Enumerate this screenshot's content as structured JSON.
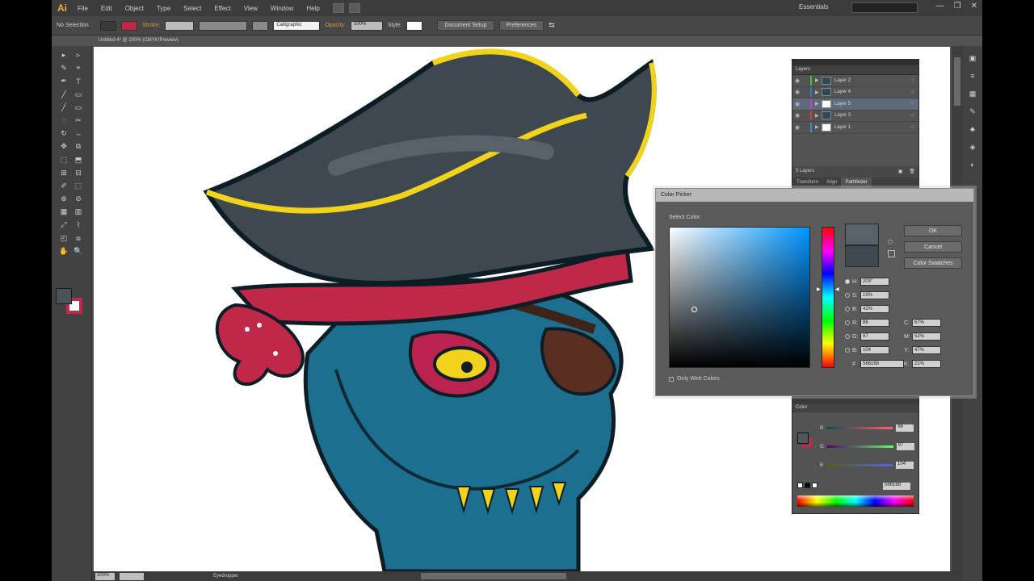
{
  "app": {
    "logo": "Ai",
    "menu": [
      "File",
      "Edit",
      "Object",
      "Type",
      "Select",
      "Effect",
      "View",
      "Window",
      "Help"
    ],
    "workspace": "Essentials",
    "window_controls": [
      "—",
      "❐",
      "✕"
    ]
  },
  "control_bar": {
    "selection_label": "No Selection",
    "stroke_label": "Stroke:",
    "brush_value": "Calligraphic",
    "opacity_label": "Opacity:",
    "opacity_value": "100%",
    "style_label": "Style:",
    "document_setup": "Document Setup",
    "preferences": "Preferences"
  },
  "document": {
    "tab_title": "Untitled-4* @ 200% (CMYK/Preview)"
  },
  "status_bar": {
    "zoom": "200%",
    "tool_name": "Eyedropper"
  },
  "layers_panel": {
    "title": "Layers",
    "layers": [
      {
        "name": "Layer 2",
        "color": "#37c837",
        "selected": false,
        "has_thumb_art": true
      },
      {
        "name": "Layer 4",
        "color": "#3d6fd6",
        "selected": false,
        "has_thumb_art": true
      },
      {
        "name": "Layer 5",
        "color": "#c43bd6",
        "selected": true,
        "has_thumb_art": false
      },
      {
        "name": "Layer 3",
        "color": "#d63b3b",
        "selected": false,
        "has_thumb_art": true
      },
      {
        "name": "Layer 1",
        "color": "#3b8ad6",
        "selected": false,
        "has_thumb_art": false
      }
    ],
    "footer_count": "5 Layers",
    "tabs": [
      "Transform",
      "Align",
      "Pathfinder"
    ],
    "active_tab": "Pathfinder"
  },
  "color_picker": {
    "title": "Color Picker",
    "select_label": "Select Color:",
    "buttons": {
      "ok": "OK",
      "cancel": "Cancel",
      "swatches": "Color Swatches"
    },
    "fields": {
      "H": {
        "label": "H:",
        "value": "203°"
      },
      "S": {
        "label": "S:",
        "value": "19%"
      },
      "B": {
        "label": "B:",
        "value": "42%"
      },
      "R": {
        "label": "R:",
        "value": "86"
      },
      "G": {
        "label": "G:",
        "value": "97"
      },
      "B2": {
        "label": "B:",
        "value": "104"
      },
      "C": {
        "label": "C:",
        "value": "67%"
      },
      "M": {
        "label": "M:",
        "value": "52%"
      },
      "Y": {
        "label": "Y:",
        "value": "47%"
      },
      "K": {
        "label": "K:",
        "value": "21%"
      },
      "hex": {
        "label": "#",
        "value": "566168"
      }
    },
    "web_only": "Only Web Colors",
    "new_color": "#566168",
    "old_color": "#3e484f"
  },
  "color_panel": {
    "title": "Color",
    "rows": [
      {
        "label": "R",
        "value": "86",
        "gradient": "#ff0000"
      },
      {
        "label": "G",
        "value": "97",
        "gradient": "#00ff00"
      },
      {
        "label": "B",
        "value": "104",
        "gradient": "#0000ff"
      }
    ],
    "hex_value": "566168"
  },
  "tools": [
    "▸",
    "▹",
    "✎",
    "⌖",
    "✒",
    "T",
    "╱",
    "▭",
    "╱",
    "▭",
    "◌",
    "✂",
    "↻",
    "⇔",
    "✥",
    "⧉",
    "⬚",
    "⬒",
    "⊞",
    "⊟",
    "✐",
    "⬚",
    "⊕",
    "⊘",
    "▦",
    "▥",
    "⤢",
    "⌇",
    "◰",
    "⧈",
    "✋",
    "🔍"
  ]
}
